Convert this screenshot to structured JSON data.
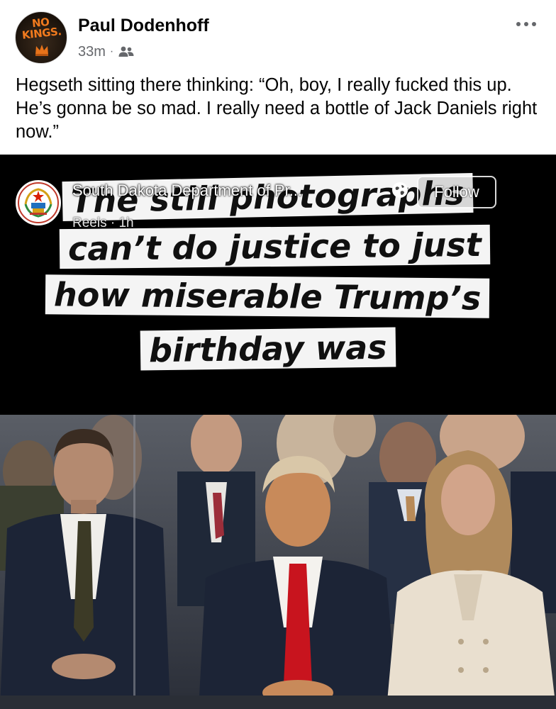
{
  "post": {
    "author": "Paul Dodenhoff",
    "time": "33m",
    "audience_icon": "friends-icon",
    "avatar_text": "NO KINGS.",
    "text": "Hegseth sitting there thinking: “Oh, boy, I really fucked this up. He’s gonna be so mad. I really need a bottle of Jack Daniels right now.”"
  },
  "reel": {
    "page_name": "South Dakota Department of Pr...",
    "sub": "Reels · 1h",
    "follow_label": "Follow",
    "caption_lines": [
      "The still photographs",
      "can’t do justice to just",
      "how miserable Trump’s",
      "birthday was"
    ]
  },
  "colors": {
    "meta_gray": "#65676b",
    "caption_bg": "#f4f4f4",
    "tie_red": "#c8141e",
    "suit_navy": "#1c2436"
  }
}
